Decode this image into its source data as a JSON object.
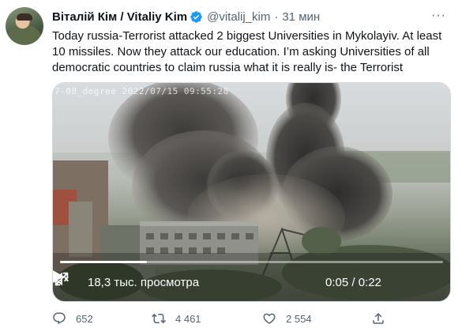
{
  "tweet": {
    "author_name": "Віталій Кім / Vitaliy Kim",
    "handle": "@vitalij_kim",
    "separator": "·",
    "time": "31 мин",
    "more_glyph": "···",
    "text": "Today russia-Terrorist attacked 2 biggest Universities in Mykolayiv. At least 10 missiles. Now they attack our education. I’m asking Universities of all democratic countries to claim russia what it is really is- the Terrorist"
  },
  "video": {
    "overlay_timestamp": "7-08_degree 2022/07/15 09:55:28",
    "views": "18,3 тыс. просмотра",
    "timer": "0:05 / 0:22",
    "progress": 0.227
  },
  "actions": {
    "replies": "652",
    "retweets": "4 461",
    "likes": "2 554"
  },
  "colors": {
    "text": "#0f1419",
    "muted": "#536471",
    "verified": "#1d9bf0"
  },
  "icons": [
    "verified-badge-icon",
    "more-icon",
    "play-icon",
    "volume-icon",
    "fullscreen-icon",
    "reply-icon",
    "retweet-icon",
    "like-icon",
    "share-icon"
  ]
}
